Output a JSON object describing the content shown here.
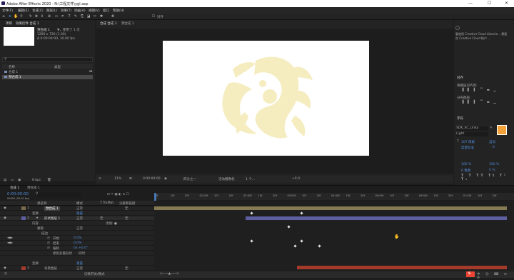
{
  "window": {
    "title": "Adobe After Effects 2020 - N:\\工程文件\\ygl.aep",
    "controls": [
      "—",
      "☐",
      "✕"
    ]
  },
  "menu": [
    "文件(F)",
    "编辑(E)",
    "合成(C)",
    "图层(L)",
    "效果(T)",
    "动画(A)",
    "视图(V)",
    "窗口",
    "帮助(H)"
  ],
  "toolbar": {
    "snap_label": "对齐"
  },
  "project": {
    "tabs": [
      "项目",
      "效果控件 合成 1"
    ],
    "selected_name": "预合成 1",
    "selected_used": "▼，使用了 1 次",
    "selected_info1": "1280 x 720 (1.00)",
    "selected_info2": "Δ 0:00:04:00, 30.00 fps",
    "col_name": "名称",
    "col_type": "类型",
    "items": [
      {
        "name": "合成 1"
      },
      {
        "name": "预合成 1"
      }
    ],
    "bpc": "8 bpc"
  },
  "comp": {
    "tabs": [
      "合成 合成 1",
      "预合成 1"
    ],
    "breadcrumb": [
      "合成 1",
      "预合成 1"
    ],
    "zoom": "11%",
    "timecode": "0:00:00:00",
    "quality": "四分之一",
    "camera": "活动摄像机",
    "views": "1 个...",
    "offset": "+0.0"
  },
  "right": {
    "sync_text": "要使用 Creative Cloud Librarie... 需要在 Creative Cloud 帐户 ...",
    "align_title": "对齐",
    "align_to": "将图层对齐到:",
    "distribute": "分布图层:",
    "char_title": "字符",
    "font": "SDK_SC_Unity",
    "font_style": "Light",
    "font_size": "107 像素",
    "leading": "自动",
    "kerning": "度量标准",
    "tracking": "0",
    "stroke_size": "100 %",
    "scale_h": "100 %",
    "baseline": "0 像素",
    "tsume": "0 %"
  },
  "timeline": {
    "tabs": [
      "合成 1",
      "预合成 1"
    ],
    "timecode": "0:00:00:00",
    "fps": "00000 (30.00 fps)",
    "col_source": "源名称",
    "col_mode": "模式",
    "col_trkmat": "T TrkMat",
    "col_parent": "父级和链接",
    "layers": [
      {
        "num": "1",
        "name": "预合成 1",
        "mode": "正常",
        "parent": "无",
        "color": "#7a6c4a"
      },
      {
        "label": "变换",
        "value": "重置"
      },
      {
        "num": "2",
        "name": "形状图层 1",
        "mode": "正常",
        "trkmat": "无",
        "parent": "无",
        "color": "#5d5fa0"
      },
      {
        "label": "内容",
        "value": "添加: ●"
      },
      {
        "label": "蒙版",
        "value": "正常"
      },
      {
        "label": "描边",
        "value": ""
      },
      {
        "label": "开始",
        "value": "0.0%"
      },
      {
        "label": "结束",
        "value": "0.0%"
      },
      {
        "label": "偏移",
        "value": "0x +0.0°"
      },
      {
        "label": "修剪多重形状",
        "value": "同时"
      },
      {
        "label": "变换",
        "value": "重置"
      },
      {
        "num": "3",
        "name": "背景图层",
        "mode": "正常",
        "parent": "无",
        "color": "#a33a2a"
      }
    ],
    "ruler": [
      "0f",
      "10f",
      "20f",
      "01:00f",
      "10f",
      "20f",
      "02:00f",
      "10f",
      "20f",
      "03:00f",
      "10f",
      "20f",
      "04:00f",
      "10f",
      "20f",
      "05:00f",
      "10f",
      "20f",
      "06:00f",
      "10f",
      "20f",
      "07:00f",
      "10f",
      "20f"
    ],
    "bottom_toggle": "切换开关/模式"
  },
  "colors": {
    "dragon": "#f5ecbf",
    "accent_blue": "#4f8bd6",
    "orange": "#f2a13a"
  }
}
